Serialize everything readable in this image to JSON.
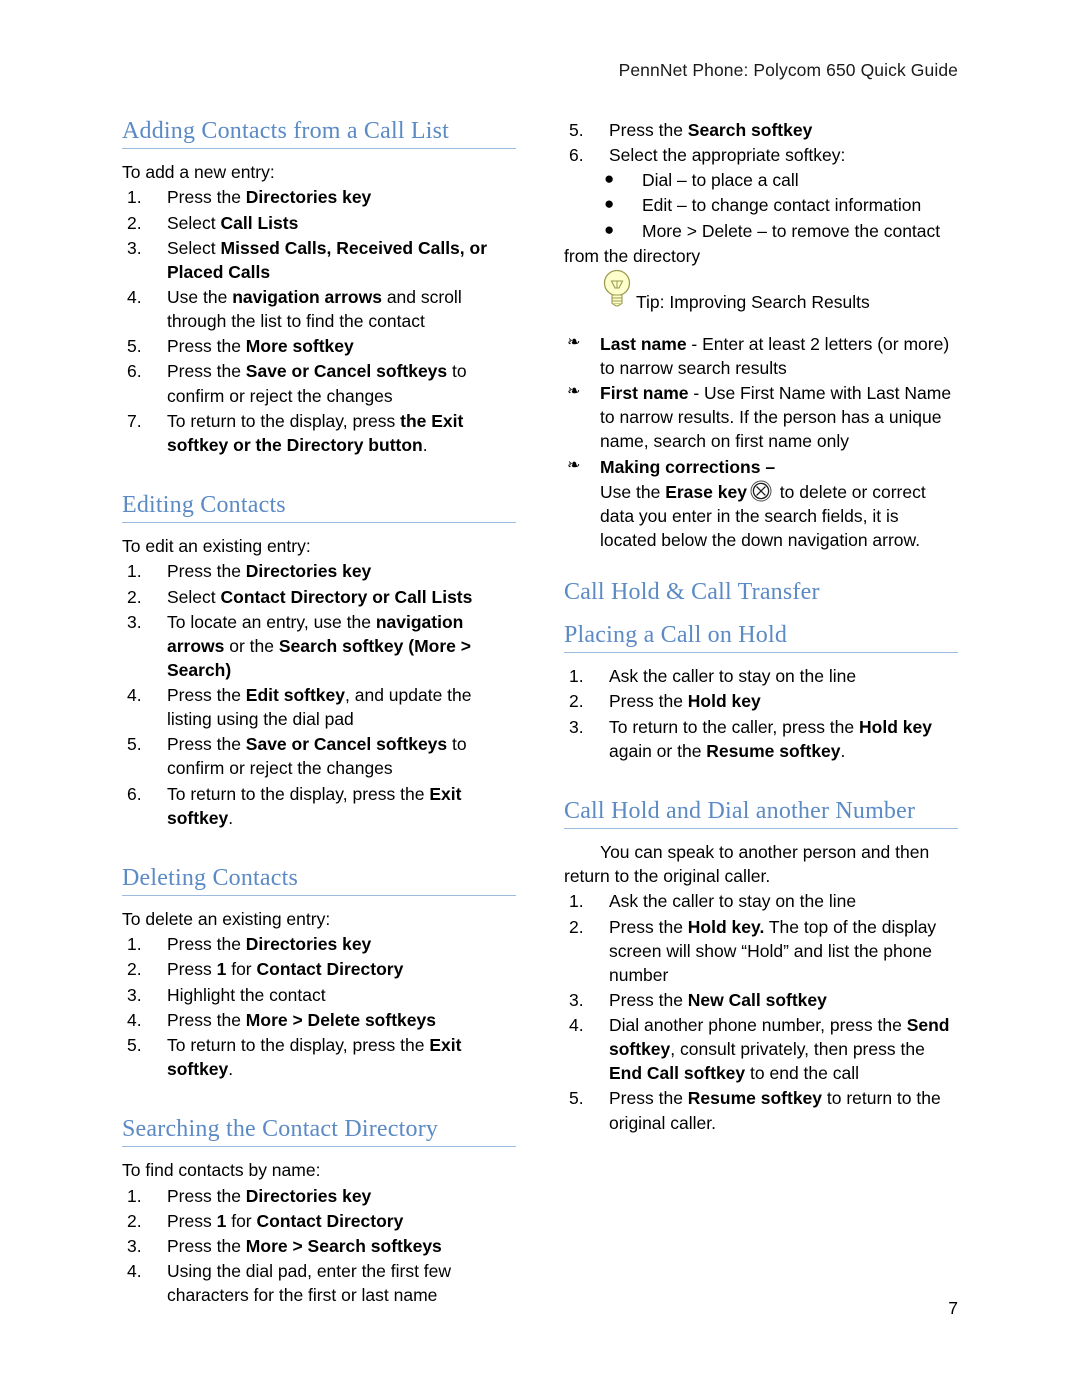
{
  "header": {
    "title": "PennNet Phone: Polycom 650 Quick Guide"
  },
  "page_number": "7",
  "colors": {
    "heading_blue": "#5b8ac5",
    "rule_blue": "#9dbbdd",
    "bulb_fill": "#ffffcc",
    "bulb_stroke": "#9a9a52"
  },
  "icons": {
    "bulb": "lightbulb-icon",
    "erase": "erase-key-icon"
  },
  "left_column": {
    "sections": [
      {
        "heading": "Adding Contacts from a Call List",
        "intro": "To add a new entry:",
        "steps": [
          {
            "num": "1.",
            "parts": [
              {
                "t": "Press the ",
                "b": false
              },
              {
                "t": "Directories key",
                "b": true
              }
            ]
          },
          {
            "num": "2.",
            "parts": [
              {
                "t": "Select ",
                "b": false
              },
              {
                "t": "Call Lists",
                "b": true
              }
            ]
          },
          {
            "num": "3.",
            "parts": [
              {
                "t": "Select ",
                "b": false
              },
              {
                "t": "Missed Calls, Received Calls, or Placed Calls",
                "b": true
              }
            ]
          },
          {
            "num": "4.",
            "parts": [
              {
                "t": "Use the ",
                "b": false
              },
              {
                "t": "navigation arrows",
                "b": true
              },
              {
                "t": " and scroll through the list to find the contact",
                "b": false
              }
            ]
          },
          {
            "num": "5.",
            "parts": [
              {
                "t": "Press the ",
                "b": false
              },
              {
                "t": "More softkey",
                "b": true
              }
            ]
          },
          {
            "num": "6.",
            "parts": [
              {
                "t": "Press the ",
                "b": false
              },
              {
                "t": "Save or Cancel softkeys",
                "b": true
              },
              {
                "t": " to confirm or reject the changes",
                "b": false
              }
            ]
          },
          {
            "num": "7.",
            "parts": [
              {
                "t": "To return to the display, press ",
                "b": false
              },
              {
                "t": "the Exit softkey or the Directory button",
                "b": true
              },
              {
                "t": ".",
                "b": false
              }
            ]
          }
        ]
      },
      {
        "heading": "Editing Contacts",
        "intro": "To edit an existing entry:",
        "steps": [
          {
            "num": "1.",
            "parts": [
              {
                "t": "Press the ",
                "b": false
              },
              {
                "t": "Directories key",
                "b": true
              }
            ]
          },
          {
            "num": "2.",
            "parts": [
              {
                "t": "Select ",
                "b": false
              },
              {
                "t": "Contact Directory or Call Lists",
                "b": true
              }
            ]
          },
          {
            "num": "3.",
            "parts": [
              {
                "t": "To locate an entry, use the ",
                "b": false
              },
              {
                "t": "navigation arrows",
                "b": true
              },
              {
                "t": " or the ",
                "b": false
              },
              {
                "t": "Search softkey (More > Search)",
                "b": true
              }
            ]
          },
          {
            "num": "4.",
            "parts": [
              {
                "t": "Press the ",
                "b": false
              },
              {
                "t": "Edit softkey",
                "b": true
              },
              {
                "t": ", and update the listing using the dial pad",
                "b": false
              }
            ]
          },
          {
            "num": "5.",
            "parts": [
              {
                "t": "Press the ",
                "b": false
              },
              {
                "t": "Save or Cancel softkeys",
                "b": true
              },
              {
                "t": " to confirm or reject the changes",
                "b": false
              }
            ]
          },
          {
            "num": "6.",
            "parts": [
              {
                "t": "To return to the display, press the ",
                "b": false
              },
              {
                "t": "Exit softkey",
                "b": true
              },
              {
                "t": ".",
                "b": false
              }
            ]
          }
        ]
      },
      {
        "heading": "Deleting Contacts",
        "intro": "To delete an existing entry:",
        "steps": [
          {
            "num": "1.",
            "parts": [
              {
                "t": "Press the ",
                "b": false
              },
              {
                "t": "Directories key",
                "b": true
              }
            ]
          },
          {
            "num": "2.",
            "parts": [
              {
                "t": "Press ",
                "b": false
              },
              {
                "t": "1",
                "b": true
              },
              {
                "t": " for ",
                "b": false
              },
              {
                "t": "Contact Directory",
                "b": true
              }
            ]
          },
          {
            "num": "3.",
            "parts": [
              {
                "t": "Highlight the contact",
                "b": false
              }
            ]
          },
          {
            "num": "4.",
            "parts": [
              {
                "t": "Press the ",
                "b": false
              },
              {
                "t": "More > Delete softkeys",
                "b": true
              }
            ]
          },
          {
            "num": "5.",
            "parts": [
              {
                "t": "To return to the display, press the ",
                "b": false
              },
              {
                "t": "Exit softkey",
                "b": true
              },
              {
                "t": ".",
                "b": false
              }
            ]
          }
        ]
      },
      {
        "heading": "Searching the Contact Directory",
        "intro": "To find contacts by name:",
        "steps": [
          {
            "num": "1.",
            "parts": [
              {
                "t": "Press the ",
                "b": false
              },
              {
                "t": "Directories key",
                "b": true
              }
            ]
          },
          {
            "num": "2.",
            "parts": [
              {
                "t": "Press ",
                "b": false
              },
              {
                "t": "1",
                "b": true
              },
              {
                "t": " for ",
                "b": false
              },
              {
                "t": "Contact Directory",
                "b": true
              }
            ]
          },
          {
            "num": "3.",
            "parts": [
              {
                "t": "Press the ",
                "b": false
              },
              {
                "t": "More > Search softkeys",
                "b": true
              }
            ]
          },
          {
            "num": "4.",
            "parts": [
              {
                "t": "Using the dial pad, enter the first few characters for the first or last name",
                "b": false
              }
            ]
          }
        ]
      }
    ]
  },
  "right_column": {
    "continued_steps": [
      {
        "num": "5.",
        "parts": [
          {
            "t": "Press the ",
            "b": false
          },
          {
            "t": "Search softkey",
            "b": true
          }
        ]
      },
      {
        "num": "6.",
        "parts": [
          {
            "t": "Select the appropriate softkey:",
            "b": false
          }
        ]
      }
    ],
    "softkey_bullets": [
      "Dial – to place a call",
      "Edit – to change contact information",
      "More > Delete – to remove the contact"
    ],
    "softkey_bullets_trailing": "from the directory",
    "tip": {
      "title": "Tip: Improving Search Results",
      "items": [
        {
          "parts": [
            {
              "t": "Last name",
              "b": true
            },
            {
              "t": " - Enter at least 2 letters (or more) to narrow search results",
              "b": false
            }
          ]
        },
        {
          "parts": [
            {
              "t": "First name",
              "b": true
            },
            {
              "t": " - Use First Name with Last Name to narrow results. If the person has a unique name, search on first name only",
              "b": false
            }
          ]
        },
        {
          "parts": [
            {
              "t": "Making corrections –",
              "b": true
            }
          ]
        }
      ],
      "corrections_pre": "Use the ",
      "corrections_bold": "Erase key",
      "corrections_post": " to delete or correct data you enter in the search fields, it is located below the down navigation arrow."
    },
    "sections": [
      {
        "heading": "Call Hold & Call Transfer",
        "level": 1,
        "rule": false
      },
      {
        "heading": "Placing a Call on Hold",
        "level": 2,
        "rule": true,
        "steps": [
          {
            "num": "1.",
            "parts": [
              {
                "t": "Ask the caller to stay on the line",
                "b": false
              }
            ]
          },
          {
            "num": "2.",
            "parts": [
              {
                "t": "Press the ",
                "b": false
              },
              {
                "t": "Hold key",
                "b": true
              }
            ]
          },
          {
            "num": "3.",
            "parts": [
              {
                "t": "To return to the caller, press the ",
                "b": false
              },
              {
                "t": "Hold key",
                "b": true
              },
              {
                "t": " again or the ",
                "b": false
              },
              {
                "t": "Resume softkey",
                "b": true
              },
              {
                "t": ".",
                "b": false
              }
            ]
          }
        ]
      },
      {
        "heading": "Call Hold and Dial another Number",
        "level": 2,
        "rule": true,
        "intro": "You can speak to another person and then return to the original caller.",
        "steps": [
          {
            "num": "1.",
            "parts": [
              {
                "t": "Ask the caller to stay on the line",
                "b": false
              }
            ]
          },
          {
            "num": "2.",
            "parts": [
              {
                "t": "Press the ",
                "b": false
              },
              {
                "t": "Hold key.",
                "b": true
              },
              {
                "t": " The top of the display screen will show “Hold” and list the phone number",
                "b": false
              }
            ]
          },
          {
            "num": "3.",
            "parts": [
              {
                "t": "Press the ",
                "b": false
              },
              {
                "t": "New Call softkey",
                "b": true
              }
            ]
          },
          {
            "num": "4.",
            "parts": [
              {
                "t": "Dial another phone number, press the ",
                "b": false
              },
              {
                "t": "Send softkey",
                "b": true
              },
              {
                "t": ", consult privately, then press the ",
                "b": false
              },
              {
                "t": "End Call softkey",
                "b": true
              },
              {
                "t": " to end the call",
                "b": false
              }
            ]
          },
          {
            "num": "5.",
            "parts": [
              {
                "t": "Press the ",
                "b": false
              },
              {
                "t": "Resume softkey",
                "b": true
              },
              {
                "t": " to return to the original caller.",
                "b": false
              }
            ]
          }
        ]
      }
    ]
  }
}
